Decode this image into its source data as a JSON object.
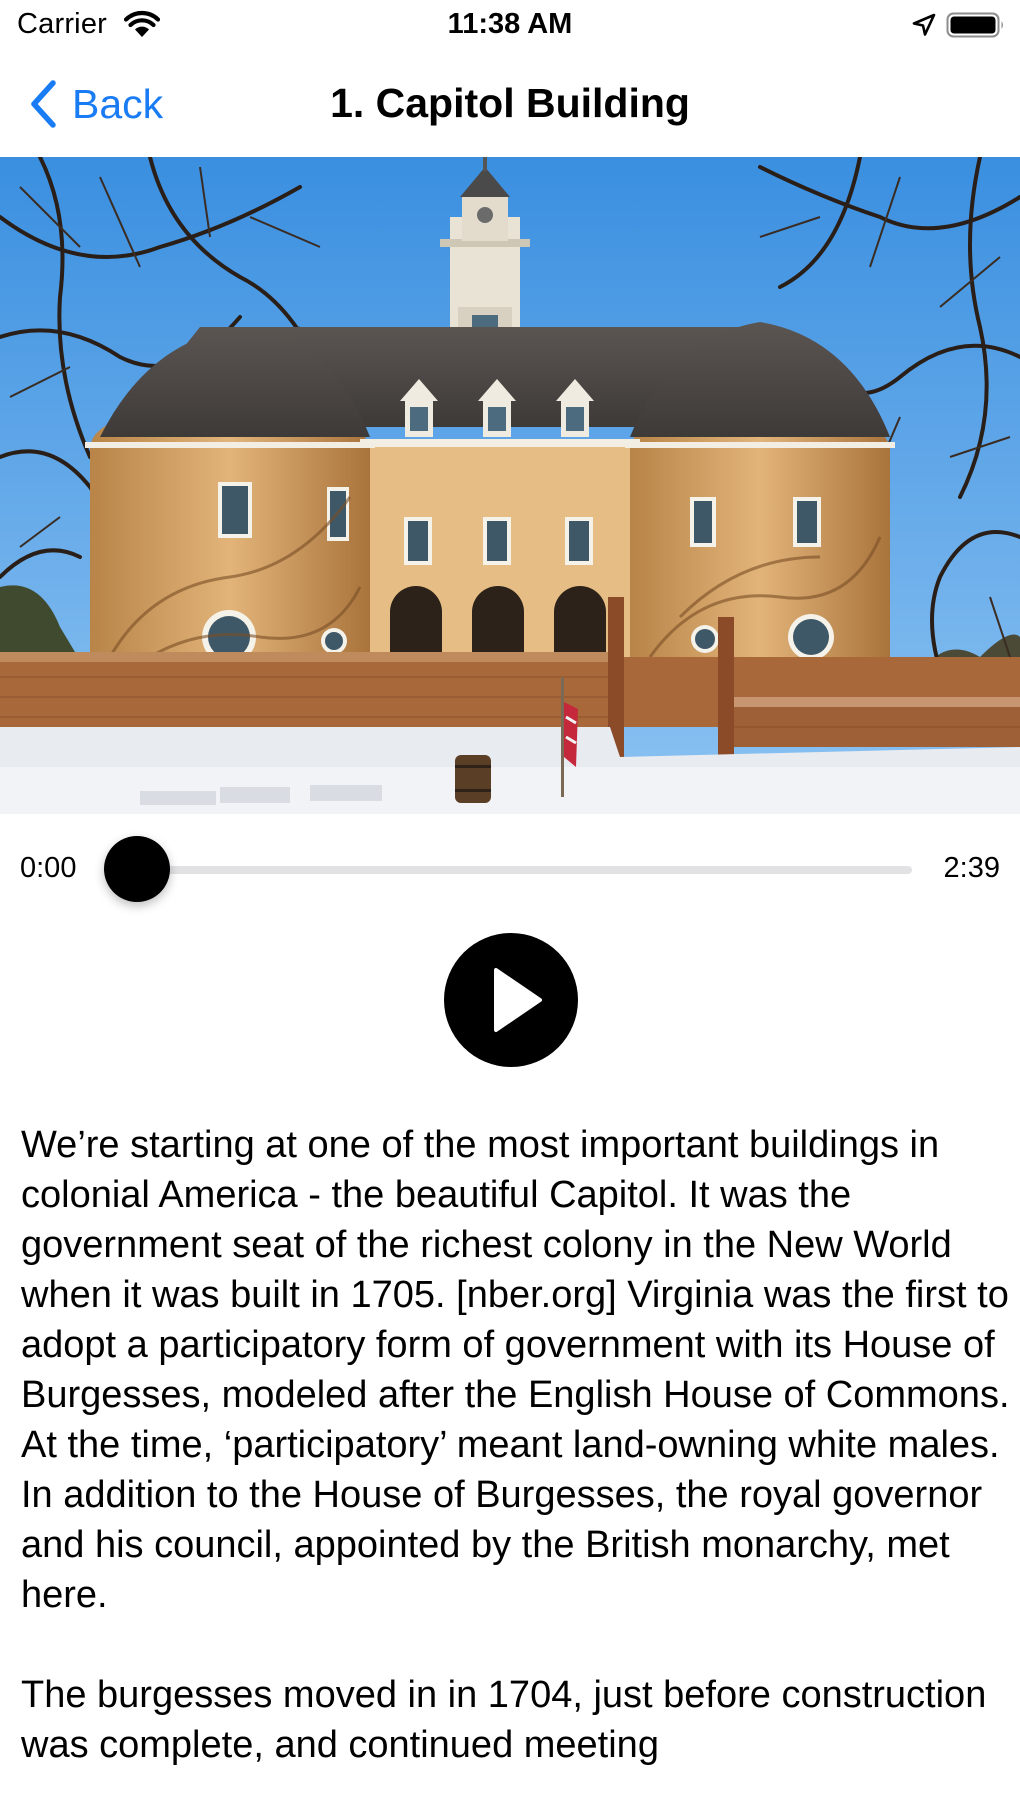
{
  "status_bar": {
    "carrier": "Carrier",
    "time": "11:38 AM"
  },
  "nav": {
    "back_label": "Back",
    "title": "1. Capitol Building"
  },
  "colors": {
    "accent": "#1a7cf5"
  },
  "player": {
    "current_time": "0:00",
    "duration": "2:39",
    "progress": 0,
    "play_icon": "play-icon"
  },
  "description": {
    "paragraphs": [
      "We’re starting at one of the most important buildings in colonial America - the beautiful Capitol. It was the government seat of the richest colony in the New World when it was built in 1705. [nber.org] Virginia was the first to adopt a participatory form of government with its House of Burgesses, modeled after the English House of Commons. At the time, ‘participatory’ meant land-owning white males. In addition to the House of Burgesses, the royal governor and his council, appointed by the British monarchy, met here.",
      "The burgesses moved in in 1704, just before construction was complete, and continued meeting"
    ]
  }
}
